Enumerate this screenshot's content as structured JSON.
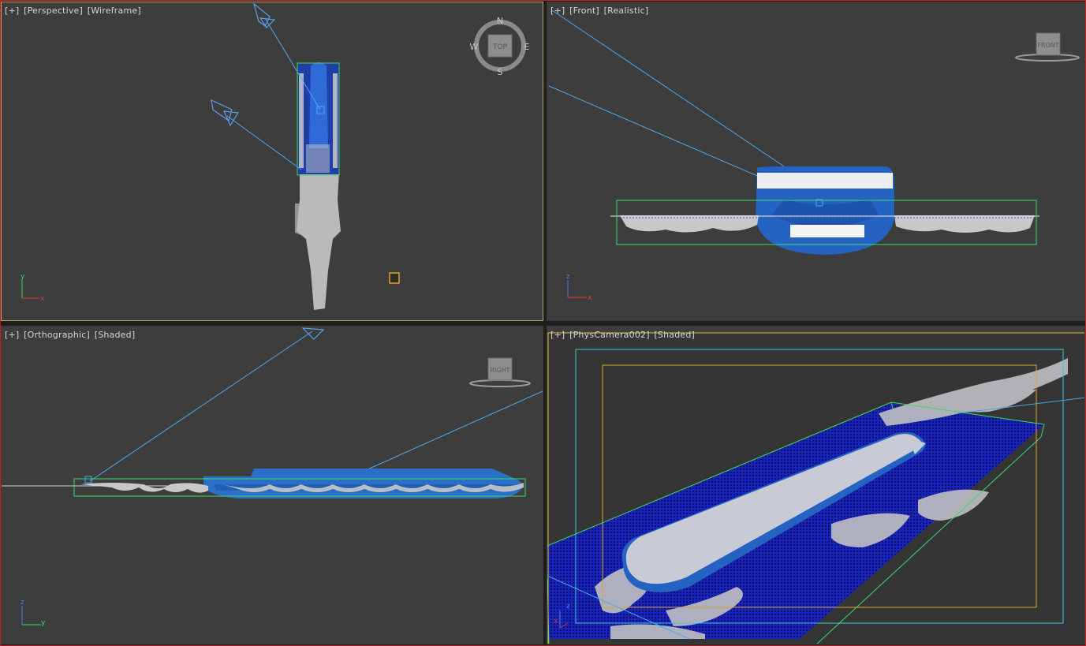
{
  "viewports": {
    "perspective": {
      "labels": [
        "[+]",
        "[Perspective]",
        "[Wireframe]"
      ],
      "compass": {
        "n": "N",
        "e": "E",
        "s": "S",
        "w": "W",
        "cube": "TOP"
      }
    },
    "front": {
      "labels": [
        "[+]",
        "[Front]",
        "[Realistic]"
      ],
      "cube": "FRONT"
    },
    "orthographic": {
      "labels": [
        "[+]",
        "[Orthographic]",
        "[Shaded]"
      ],
      "cube": "RIGHT"
    },
    "camera": {
      "labels": [
        "[+]",
        "[PhysCamera002]",
        "[Shaded]"
      ]
    }
  },
  "axes": {
    "tl": {
      "vert": "y",
      "horiz": "x"
    },
    "tr": {
      "vert": "z",
      "horiz": "x"
    },
    "bl": {
      "vert": "z",
      "horiz": "y"
    },
    "br": {
      "vert": "z",
      "horiz": "x"
    }
  },
  "colors": {
    "viewport_bg": "#3d3d3d",
    "active_border": "#b8a46a",
    "selection_green": "#3ad86a",
    "camera_blue": "#4aa8e8",
    "hull_blue": "#2b6fc7",
    "foam": "#c8c8c8",
    "safe_frame_yellow": "#d9a630",
    "safe_frame_cyan": "#3fc6d8"
  }
}
